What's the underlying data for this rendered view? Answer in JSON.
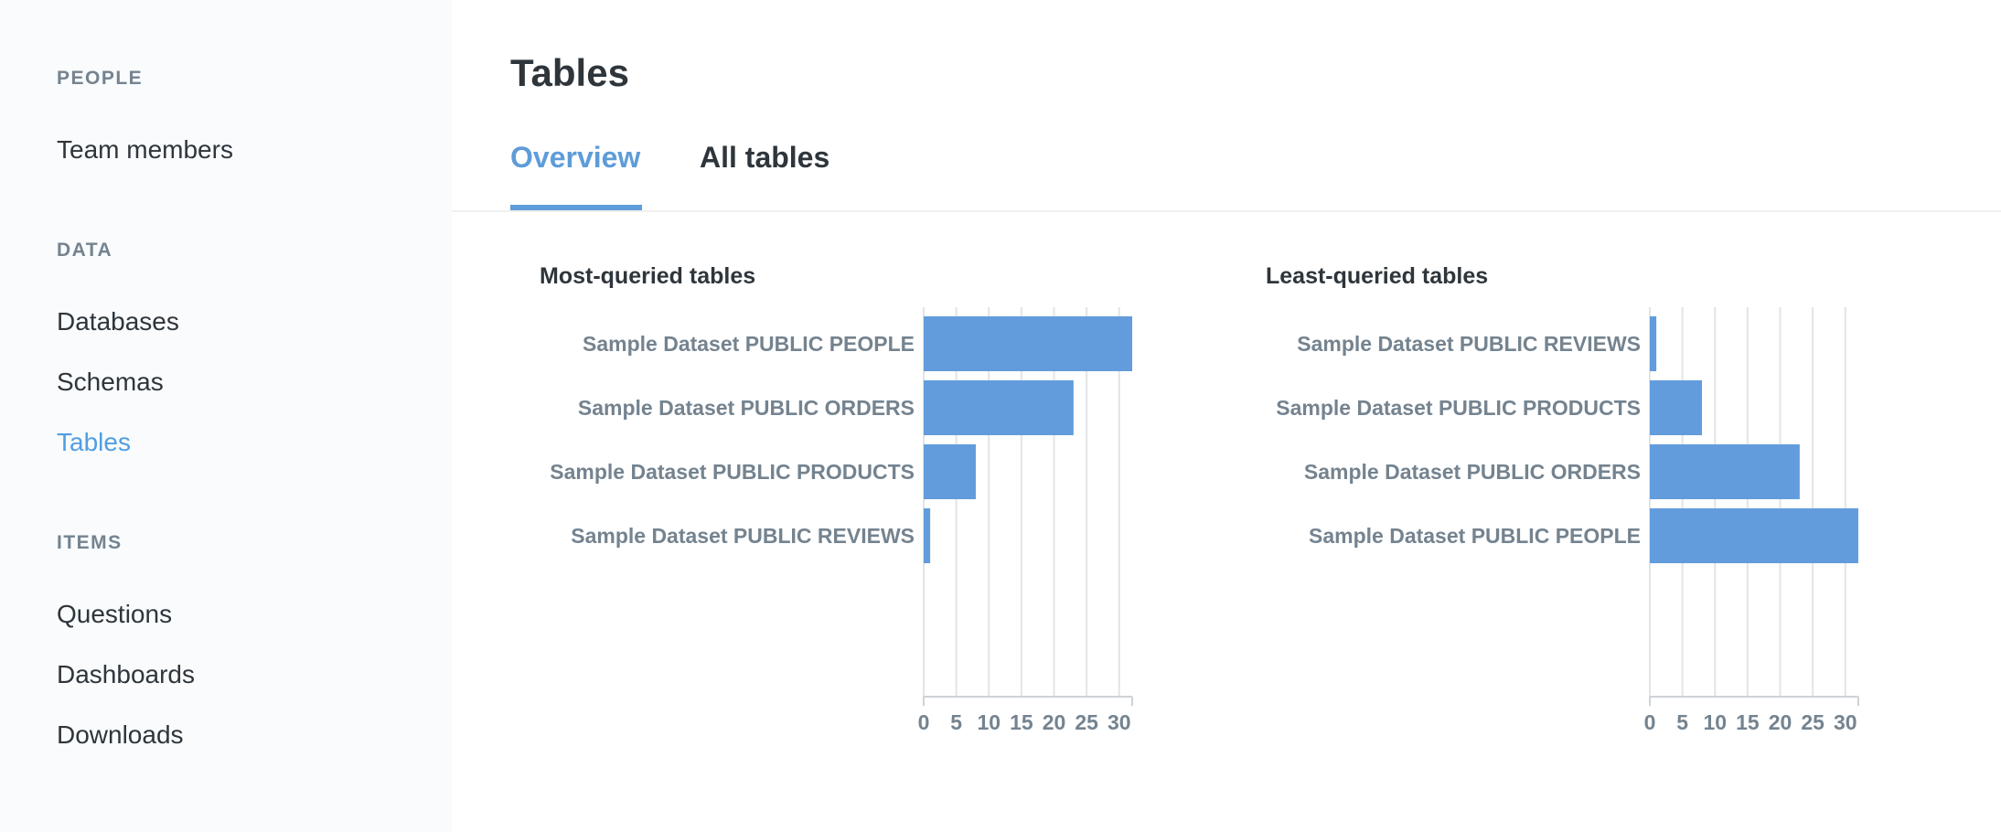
{
  "sidebar": {
    "sections": [
      {
        "label": "PEOPLE",
        "items": [
          {
            "label": "Team members",
            "active": false
          }
        ]
      },
      {
        "label": "DATA",
        "items": [
          {
            "label": "Databases",
            "active": false
          },
          {
            "label": "Schemas",
            "active": false
          },
          {
            "label": "Tables",
            "active": true
          }
        ]
      },
      {
        "label": "ITEMS",
        "items": [
          {
            "label": "Questions",
            "active": false
          },
          {
            "label": "Dashboards",
            "active": false
          },
          {
            "label": "Downloads",
            "active": false
          }
        ]
      }
    ]
  },
  "main": {
    "title": "Tables",
    "tabs": [
      {
        "label": "Overview",
        "active": true
      },
      {
        "label": "All tables",
        "active": false
      }
    ]
  },
  "colors": {
    "accent": "#5e9cd9",
    "bar": "#629cdc",
    "label": "#74838f",
    "grid": "#e2e4e6"
  },
  "chart_data": [
    {
      "type": "bar",
      "orientation": "horizontal",
      "title": "Most-queried tables",
      "categories": [
        "Sample Dataset PUBLIC PEOPLE",
        "Sample Dataset PUBLIC ORDERS",
        "Sample Dataset PUBLIC PRODUCTS",
        "Sample Dataset PUBLIC REVIEWS"
      ],
      "values": [
        32,
        23,
        8,
        1
      ],
      "xticks": [
        "0",
        "5",
        "10",
        "15",
        "20",
        "25",
        "30"
      ],
      "xlim": [
        0,
        32
      ],
      "xlabel": "",
      "ylabel": "",
      "grid": true
    },
    {
      "type": "bar",
      "orientation": "horizontal",
      "title": "Least-queried tables",
      "categories": [
        "Sample Dataset PUBLIC REVIEWS",
        "Sample Dataset PUBLIC PRODUCTS",
        "Sample Dataset PUBLIC ORDERS",
        "Sample Dataset PUBLIC PEOPLE"
      ],
      "values": [
        1,
        8,
        23,
        32
      ],
      "xticks": [
        "0",
        "5",
        "10",
        "15",
        "20",
        "25",
        "30"
      ],
      "xlim": [
        0,
        32
      ],
      "xlabel": "",
      "ylabel": "",
      "grid": true
    }
  ]
}
